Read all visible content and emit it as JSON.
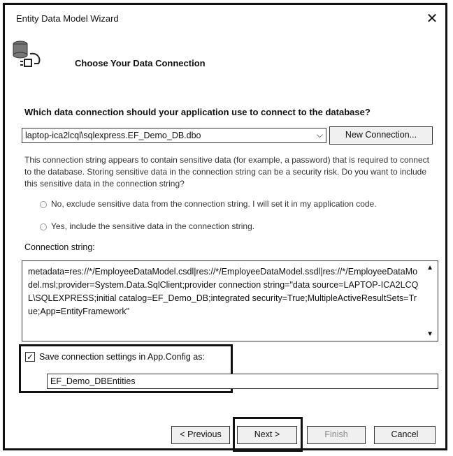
{
  "window": {
    "title": "Entity Data Model Wizard",
    "close_glyph": "✕"
  },
  "header": {
    "icon": "database-icon",
    "title": "Choose Your Data Connection"
  },
  "question": "Which data connection should your application use to connect to the database?",
  "connection_combo": {
    "value": "laptop-ica2lcql\\sqlexpress.EF_Demo_DB.dbo",
    "arrow": "⌵"
  },
  "new_connection_label": "New Connection...",
  "sensitive_info": "This connection string appears to contain sensitive data (for example, a password) that is required to connect to the database. Storing sensitive data in the connection string can be a security risk. Do you want to include this sensitive data in the connection string?",
  "radio_options": [
    "No, exclude sensitive data from the connection string. I will set it in my application code.",
    "Yes, include the sensitive data in the connection string."
  ],
  "connection_string_label": "Connection string:",
  "connection_string": "metadata=res://*/EmployeeDataModel.csdl|res://*/EmployeeDataModel.ssdl|res://*/EmployeeDataModel.msl;provider=System.Data.SqlClient;provider connection string=\"data source=LAPTOP-ICA2LCQL\\SQLEXPRESS;initial catalog=EF_Demo_DB;integrated security=True;MultipleActiveResultSets=True;App=EntityFramework\"",
  "save_settings": {
    "checked": true,
    "check_glyph": "✓",
    "label": "Save connection settings in App.Config as:",
    "value": "EF_Demo_DBEntities"
  },
  "buttons": {
    "previous": "< Previous",
    "next": "Next >",
    "finish": "Finish",
    "cancel": "Cancel"
  }
}
